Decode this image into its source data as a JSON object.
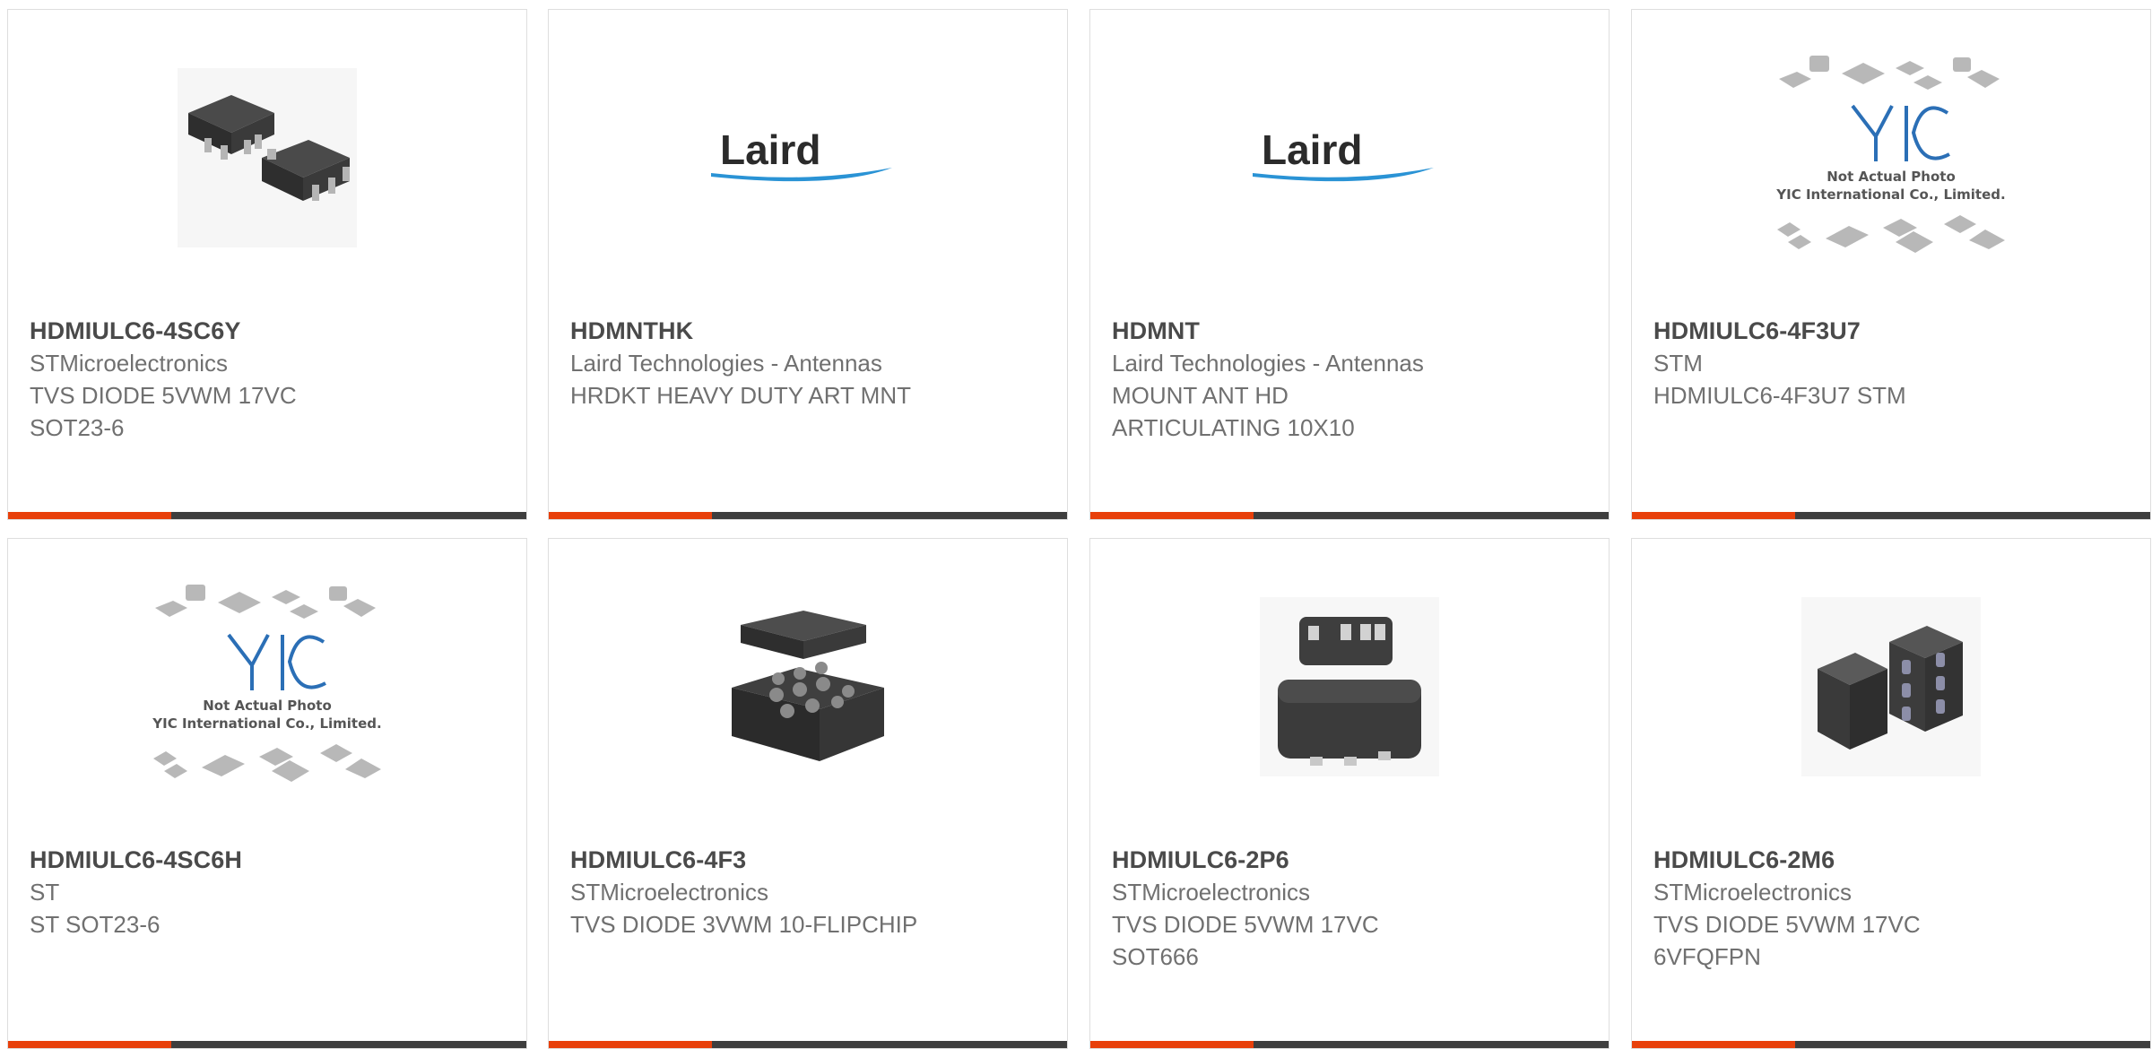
{
  "accent_color": "#e8400b",
  "bar_color": "#3e3e3e",
  "products": [
    {
      "part_number": "HDMIULC6-4SC6Y",
      "manufacturer": "STMicroelectronics",
      "desc_line1": "TVS DIODE 5VWM 17VC",
      "desc_line2": "SOT23-6",
      "image": "sot23-6-chip-photo"
    },
    {
      "part_number": "HDMNTHK",
      "manufacturer": "Laird Technologies - Antennas",
      "desc_line1": "HRDKT HEAVY DUTY ART MNT",
      "desc_line2": "",
      "image": "laird-logo",
      "logo_text": "Laird"
    },
    {
      "part_number": "HDMNT",
      "manufacturer": "Laird Technologies - Antennas",
      "desc_line1": "MOUNT ANT HD",
      "desc_line2": "ARTICULATING 10X10",
      "image": "laird-logo",
      "logo_text": "Laird"
    },
    {
      "part_number": "HDMIULC6-4F3U7",
      "manufacturer": "STM",
      "desc_line1": "HDMIULC6-4F3U7 STM",
      "desc_line2": "",
      "image": "yic-placeholder",
      "placeholder_line1": "Not Actual Photo",
      "placeholder_line2": "YIC International Co., Limited."
    },
    {
      "part_number": "HDMIULC6-4SC6H",
      "manufacturer": "ST",
      "desc_line1": "ST SOT23-6",
      "desc_line2": "",
      "image": "yic-placeholder",
      "placeholder_line1": "Not Actual Photo",
      "placeholder_line2": "YIC International Co., Limited."
    },
    {
      "part_number": "HDMIULC6-4F3",
      "manufacturer": "STMicroelectronics",
      "desc_line1": "TVS DIODE 3VWM 10-FLIPCHIP",
      "desc_line2": "",
      "image": "flipchip-bga-photo"
    },
    {
      "part_number": "HDMIULC6-2P6",
      "manufacturer": "STMicroelectronics",
      "desc_line1": "TVS DIODE 5VWM 17VC",
      "desc_line2": "SOT666",
      "image": "sot666-chip-photo"
    },
    {
      "part_number": "HDMIULC6-2M6",
      "manufacturer": "STMicroelectronics",
      "desc_line1": "TVS DIODE 5VWM 17VC",
      "desc_line2": "6VFQFPN",
      "image": "qfn-chip-photo"
    }
  ]
}
